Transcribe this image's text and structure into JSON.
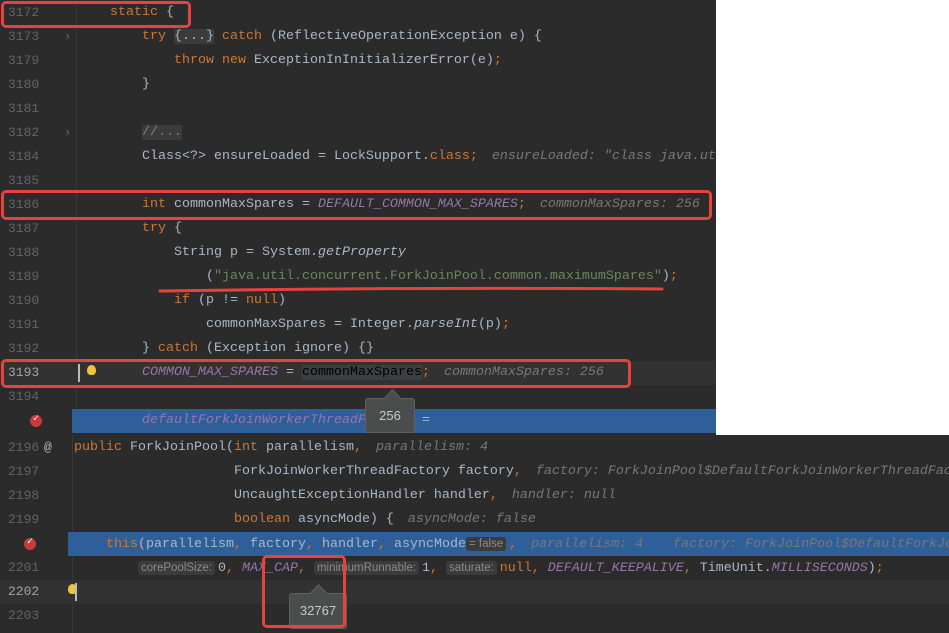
{
  "top_editor": {
    "lines": [
      {
        "num": "3172",
        "tokens": [
          [
            "kw",
            "    static "
          ],
          [
            "id",
            "{"
          ]
        ]
      },
      {
        "num": "3173",
        "fold": true,
        "tokens": [
          [
            "kw",
            "        try "
          ],
          [
            "fold",
            "{...}"
          ],
          [
            "kw",
            " catch "
          ],
          [
            "id",
            "(ReflectiveOperationException e) {"
          ]
        ]
      },
      {
        "num": "3179",
        "tokens": [
          [
            "kw",
            "            throw new "
          ],
          [
            "id",
            "ExceptionInInitializerError(e)"
          ],
          [
            "kw",
            ";"
          ]
        ]
      },
      {
        "num": "3180",
        "tokens": [
          [
            "id",
            "        }"
          ]
        ]
      },
      {
        "num": "3181",
        "tokens": []
      },
      {
        "num": "3182",
        "fold": true,
        "tokens": [
          [
            "id",
            "        "
          ],
          [
            "cmt",
            "//..."
          ]
        ]
      },
      {
        "num": "3184",
        "tokens": [
          [
            "id",
            "        Class<?> ensureLoaded = LockSupport."
          ],
          [
            "kw",
            "class;"
          ],
          [
            "hint",
            " ensureLoaded: \"class java.util.concurrent.locks.LockSupport\""
          ]
        ]
      },
      {
        "num": "3185",
        "tokens": []
      },
      {
        "num": "3186",
        "tokens": [
          [
            "kw",
            "        int "
          ],
          [
            "id",
            "commonMaxSpares = "
          ],
          [
            "const",
            "DEFAULT_COMMON_MAX_SPARES"
          ],
          [
            "kw",
            ";"
          ],
          [
            "hint",
            " commonMaxSpares: 256"
          ]
        ]
      },
      {
        "num": "3187",
        "tokens": [
          [
            "kw",
            "        try "
          ],
          [
            "id",
            "{"
          ]
        ]
      },
      {
        "num": "3188",
        "tokens": [
          [
            "id",
            "            String p = System."
          ],
          [
            "mi",
            "getProperty"
          ]
        ]
      },
      {
        "num": "3189",
        "tokens": [
          [
            "id",
            "                ("
          ],
          [
            "str",
            "\"java.util.concurrent.ForkJoinPool.common.maximumSpares\""
          ],
          [
            "id",
            ")"
          ],
          [
            "kw",
            ";"
          ]
        ]
      },
      {
        "num": "3190",
        "tokens": [
          [
            "kw",
            "            if "
          ],
          [
            "id",
            "(p != "
          ],
          [
            "kw",
            "null"
          ],
          [
            "id",
            ")"
          ]
        ]
      },
      {
        "num": "3191",
        "tokens": [
          [
            "id",
            "                commonMaxSpares = Integer."
          ],
          [
            "mi",
            "parseInt"
          ],
          [
            "id",
            "(p)"
          ],
          [
            "kw",
            ";"
          ]
        ]
      },
      {
        "num": "3192",
        "tokens": [
          [
            "id",
            "        } "
          ],
          [
            "kw",
            "catch "
          ],
          [
            "id",
            "(Exception ignore) {}"
          ]
        ]
      },
      {
        "num": "3193",
        "current": true,
        "bulb": true,
        "tokens": [
          [
            "const",
            "        COMMON_MAX_SPARES"
          ],
          [
            "id",
            " = "
          ],
          [
            "selvar",
            "commonMaxSpares"
          ],
          [
            "kw",
            ";"
          ],
          [
            "hint",
            " commonMaxSpares: 256"
          ]
        ]
      },
      {
        "num": "3194",
        "tokens": []
      },
      {
        "num": "",
        "exec": true,
        "breakpoint": true,
        "tokens": [
          [
            "const",
            "        defaultForkJoinWorkerThreadFactory"
          ],
          [
            "id",
            " ="
          ]
        ]
      }
    ],
    "tooltip": "256"
  },
  "bottom_editor": {
    "lines": [
      {
        "num": "2196",
        "annotation": "@",
        "tokens": [
          [
            "kw",
            "public "
          ],
          [
            "id",
            "ForkJoinPool("
          ],
          [
            "kw",
            "int "
          ],
          [
            "id",
            "parallelism"
          ],
          [
            "kw",
            ","
          ],
          [
            "hint",
            " parallelism: 4"
          ]
        ]
      },
      {
        "num": "2197",
        "tokens": [
          [
            "id",
            "                    ForkJoinWorkerThreadFactory factory"
          ],
          [
            "kw",
            ","
          ],
          [
            "hint",
            " factory: ForkJoinPool$DefaultForkJoinWorkerThreadFactory@"
          ]
        ]
      },
      {
        "num": "2198",
        "tokens": [
          [
            "id",
            "                    UncaughtExceptionHandler handler"
          ],
          [
            "kw",
            ","
          ],
          [
            "hint",
            " handler: null"
          ]
        ]
      },
      {
        "num": "2199",
        "tokens": [
          [
            "kw",
            "                    boolean "
          ],
          [
            "id",
            "asyncMode) {"
          ],
          [
            "hint",
            " asyncMode: false"
          ]
        ]
      },
      {
        "num": "",
        "exec": true,
        "breakpoint": true,
        "tokens": [
          [
            "kw",
            "    this"
          ],
          [
            "id",
            "(parallelism"
          ],
          [
            "kw",
            ", "
          ],
          [
            "id",
            "factory"
          ],
          [
            "kw",
            ", "
          ],
          [
            "id",
            "handler"
          ],
          [
            "kw",
            ", "
          ],
          [
            "id",
            "asyncMode"
          ],
          [
            "ph",
            "= false"
          ],
          [
            "kw",
            ","
          ],
          [
            "hint",
            " parallelism: 4"
          ],
          [
            "hint",
            "   factory: ForkJoinPool$DefaultForkJoinWorkerThreadFactory@"
          ]
        ]
      },
      {
        "num": "2201",
        "tokens": [
          [
            "id",
            "        "
          ],
          [
            "ph",
            "corePoolSize:"
          ],
          [
            "id",
            "0"
          ],
          [
            "kw",
            ", "
          ],
          [
            "const",
            "MAX_CAP"
          ],
          [
            "kw",
            ", "
          ],
          [
            "ph",
            "minimumRunnable:"
          ],
          [
            "id",
            "1"
          ],
          [
            "kw",
            ", "
          ],
          [
            "ph",
            "saturate:"
          ],
          [
            "kw",
            "null, "
          ],
          [
            "const",
            "DEFAULT_KEEPALIVE"
          ],
          [
            "kw",
            ", "
          ],
          [
            "id",
            "TimeUnit."
          ],
          [
            "const",
            "MILLISECONDS"
          ],
          [
            "id",
            ")"
          ],
          [
            "kw",
            ";"
          ]
        ]
      },
      {
        "num": "2202",
        "current": true,
        "bulb": true,
        "tokens": []
      },
      {
        "num": "2203",
        "tokens": []
      }
    ],
    "tooltip": "32767"
  },
  "colors": {
    "keyword": "#cc7832",
    "identifier": "#a9b7c6",
    "constant": "#9876aa",
    "string": "#6a8759",
    "hint": "#787878",
    "execution_line": "#2f5f98",
    "annotation_box": "#e8413e"
  }
}
